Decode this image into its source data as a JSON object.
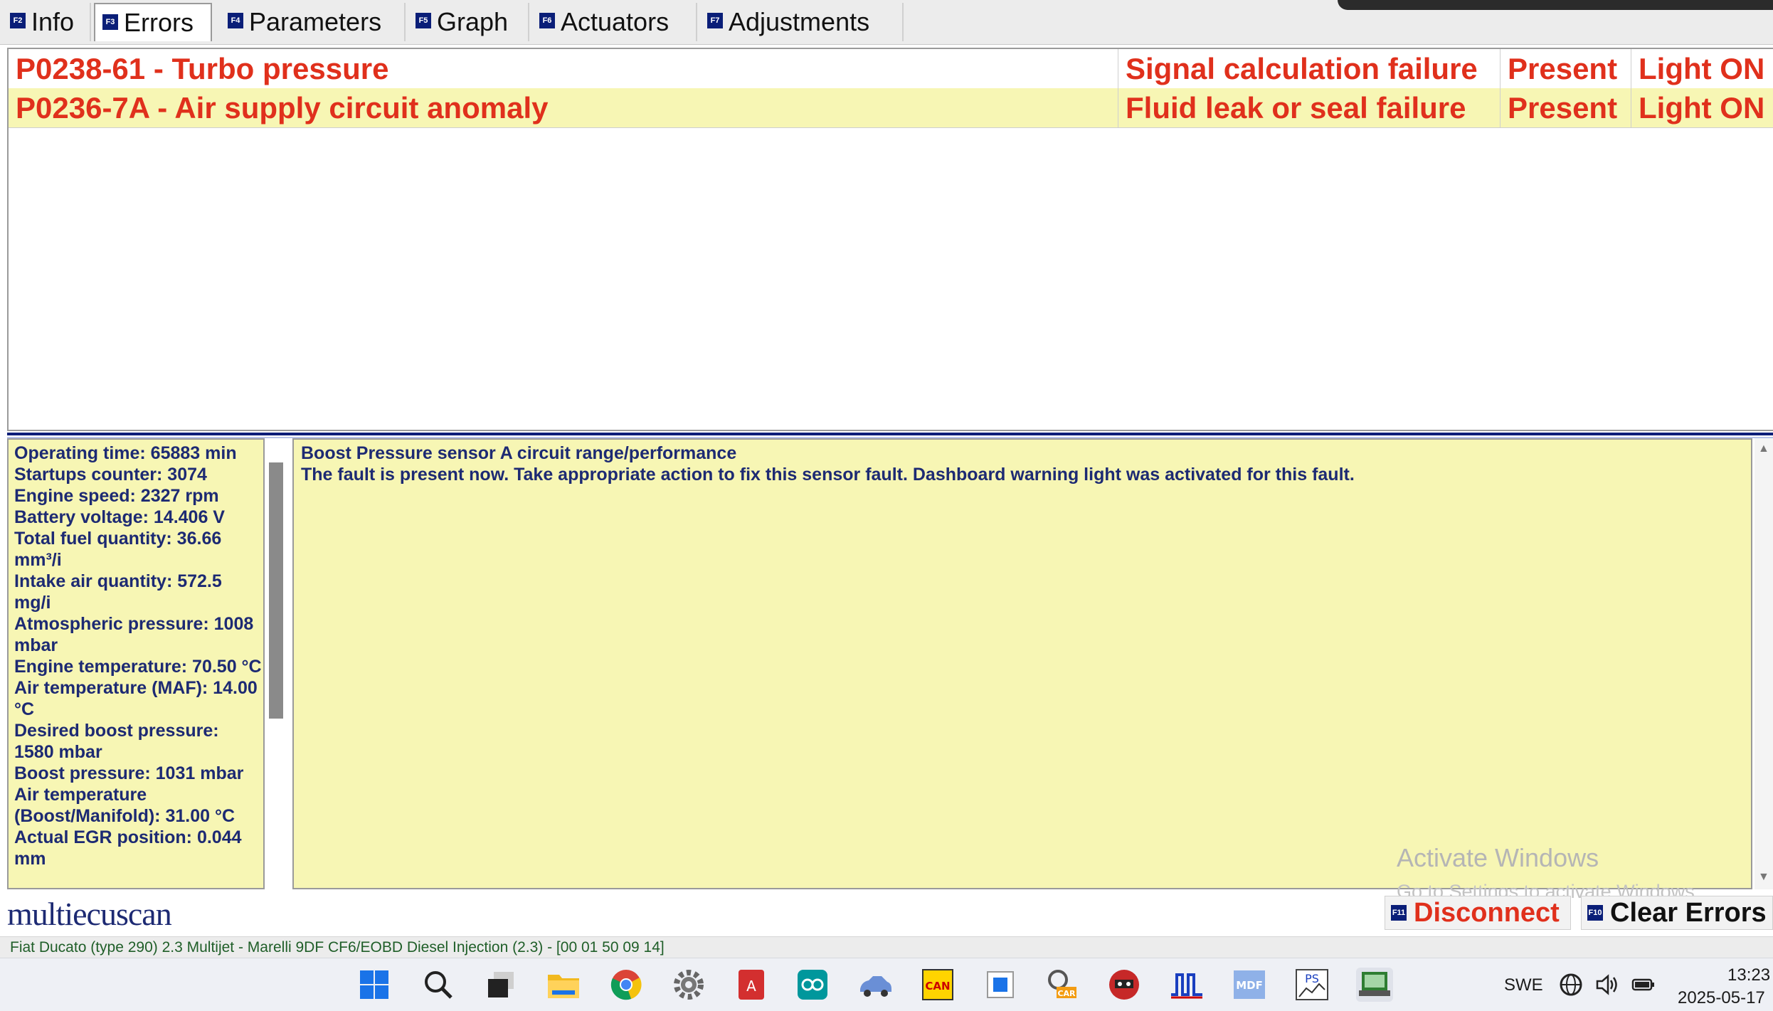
{
  "tabs": [
    {
      "key": "F2",
      "label": "Info"
    },
    {
      "key": "F3",
      "label": "Errors"
    },
    {
      "key": "F4",
      "label": "Parameters"
    },
    {
      "key": "F5",
      "label": "Graph"
    },
    {
      "key": "F6",
      "label": "Actuators"
    },
    {
      "key": "F7",
      "label": "Adjustments"
    }
  ],
  "active_tab": "Errors",
  "errors": [
    {
      "code": "P0238-61 - Turbo pressure",
      "type": "Signal calculation failure",
      "status": "Present",
      "light": "Light ON"
    },
    {
      "code": "P0236-7A - Air supply circuit anomaly",
      "type": "Fluid leak or seal failure",
      "status": "Present",
      "light": "Light ON"
    }
  ],
  "parameters": [
    "Operating time: 65883 min",
    "Startups counter: 3074",
    "Engine speed: 2327 rpm",
    "Battery voltage: 14.406 V",
    "Total fuel quantity: 36.66 mm³/i",
    "Intake air quantity: 572.5 mg/i",
    "Atmospheric pressure: 1008 mbar",
    "Engine temperature: 70.50 °C",
    "Air temperature (MAF): 14.00 °C",
    "Desired boost pressure: 1580 mbar",
    "Boost pressure: 1031 mbar",
    "Air temperature (Boost/Manifold): 31.00 °C",
    "Actual EGR position: 0.044 mm"
  ],
  "description": {
    "title": "Boost Pressure sensor A circuit range/performance",
    "body": "The fault is present now. Take appropriate action to fix this sensor fault. Dashboard warning light was activated for this fault."
  },
  "watermark": {
    "line1": "Activate Windows",
    "line2": "Go to Settings to activate Windows."
  },
  "brand": "multiecuscan",
  "buttons": {
    "disconnect": {
      "key": "F11",
      "label": "Disconnect",
      "color": "#e0301c"
    },
    "clear_errors": {
      "key": "F10",
      "label": "Clear Errors",
      "color": "#111111"
    }
  },
  "status_line": "Fiat Ducato (type 290) 2.3 Multijet - Marelli 9DF CF6/EOBD Diesel Injection (2.3) - [00 01 50 09 14]",
  "taskbar": {
    "icons": [
      "windows-start-icon",
      "search-icon",
      "task-view-icon",
      "file-explorer-icon",
      "chrome-icon",
      "settings-icon",
      "acrobat-icon",
      "arduino-icon",
      "car-app-icon",
      "can-tool-icon",
      "notepad-icon",
      "car-tools-icon",
      "helmet-app-icon",
      "signal-app-icon",
      "mdf-app-icon",
      "ps-app-icon",
      "multiecuscan-icon"
    ],
    "language": "SWE",
    "time": "13:23",
    "date": "2025-05-17"
  },
  "colors": {
    "accent_navy": "#0a1e78",
    "error_red": "#e0301c",
    "panel_yellow": "#f7f6b4",
    "param_text": "#1d2a73"
  }
}
